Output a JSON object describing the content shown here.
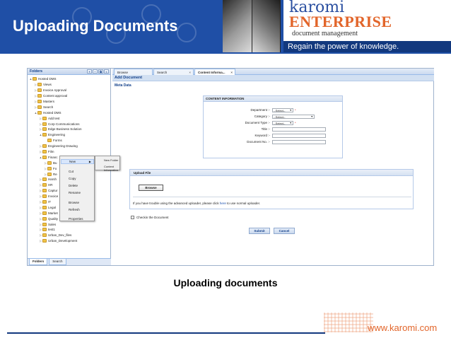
{
  "header": {
    "title": "Uploading Documents",
    "brand_name": "karomi",
    "brand_product": "ENTERPRISE",
    "brand_sub": "document management",
    "brand_tagline": "Regain the power of knowledge.",
    "bg_color": "#1f4fa6",
    "accent_color": "#e2652a"
  },
  "folders_panel": {
    "title": "Folders",
    "tree": [
      {
        "label": "Hosted DMS",
        "depth": 0,
        "toggle": "▲"
      },
      {
        "label": "Views",
        "depth": 1,
        "toggle": "▷"
      },
      {
        "label": "Invoice Approval",
        "depth": 1,
        "toggle": "▷"
      },
      {
        "label": "Content approval",
        "depth": 1,
        "toggle": "▷"
      },
      {
        "label": "Masters",
        "depth": 1,
        "toggle": "▷"
      },
      {
        "label": "Search",
        "depth": 1,
        "toggle": "▷"
      },
      {
        "label": "Hosted DMS",
        "depth": 1,
        "toggle": "▲"
      },
      {
        "label": "Add test",
        "depth": 2,
        "toggle": "▷"
      },
      {
        "label": "Corp Communications",
        "depth": 2,
        "toggle": "▷"
      },
      {
        "label": "Edge Business Solution",
        "depth": 2,
        "toggle": "▷"
      },
      {
        "label": "Engineering",
        "depth": 2,
        "toggle": "▲"
      },
      {
        "label": "Forms",
        "depth": 3,
        "toggle": ""
      },
      {
        "label": "Engineering Drawing",
        "depth": 2,
        "toggle": "▷"
      },
      {
        "label": "Film",
        "depth": 2,
        "toggle": "▷"
      },
      {
        "label": "Financ",
        "depth": 2,
        "toggle": "▲"
      },
      {
        "label": "Bu",
        "depth": 3,
        "toggle": "▷"
      },
      {
        "label": "Fo",
        "depth": 3,
        "toggle": "▷"
      },
      {
        "label": "Re",
        "depth": 3,
        "toggle": "▷"
      },
      {
        "label": "Harsh",
        "depth": 2,
        "toggle": "▷"
      },
      {
        "label": "HR",
        "depth": 2,
        "toggle": "▷"
      },
      {
        "label": "Captur",
        "depth": 2,
        "toggle": "▷"
      },
      {
        "label": "Invoice",
        "depth": 2,
        "toggle": "▷"
      },
      {
        "label": "IT",
        "depth": 2,
        "toggle": "▷"
      },
      {
        "label": "Legal",
        "depth": 2,
        "toggle": "▷"
      },
      {
        "label": "Market",
        "depth": 2,
        "toggle": "▷"
      },
      {
        "label": "Quality",
        "depth": 2,
        "toggle": "▷"
      },
      {
        "label": "Sales",
        "depth": 2,
        "toggle": "▷"
      },
      {
        "label": "test1",
        "depth": 2,
        "toggle": "▷"
      },
      {
        "label": "Urban_Dev_files",
        "depth": 2,
        "toggle": "▷"
      },
      {
        "label": "Urban_Development",
        "depth": 2,
        "toggle": "▷"
      }
    ],
    "tabs": [
      "Folders",
      "Search"
    ]
  },
  "context_menu": {
    "items": [
      "New",
      "Cut",
      "Copy",
      "Delete",
      "Rename",
      "Browse",
      "Refresh",
      "Properties"
    ],
    "submenu": [
      "New Folder",
      "Content Information"
    ]
  },
  "tabs": [
    "Browse",
    "Search",
    "Content Informa..."
  ],
  "main": {
    "title": "Add Document",
    "meta_label": "Meta Data",
    "content_info": {
      "title": "CONTENT INFORMATION",
      "fields": [
        {
          "label": "Department :-",
          "value": "--Select--",
          "type": "select",
          "required": true
        },
        {
          "label": "Category :-",
          "value": "--Select--",
          "type": "select",
          "required": false
        },
        {
          "label": "Document Type :-",
          "value": "--Select--",
          "type": "select",
          "required": true
        },
        {
          "label": "Title :-",
          "value": "",
          "type": "text",
          "required": false
        },
        {
          "label": "Keyword :-",
          "value": "",
          "type": "text",
          "required": false
        },
        {
          "label": "Document No. :-",
          "value": "",
          "type": "text",
          "required": false
        }
      ]
    },
    "upload": {
      "title": "Upload File",
      "browse_label": "Browse",
      "note_prefix": "If you have trouble using the advanced uploader, please click",
      "note_link": "here",
      "note_suffix": "to use normal uploader."
    },
    "checkin_label": "Checkin the Document",
    "submit_label": "Submit",
    "cancel_label": "Cancel"
  },
  "caption": "Uploading documents",
  "footer": {
    "url": "www.karomi.com"
  }
}
